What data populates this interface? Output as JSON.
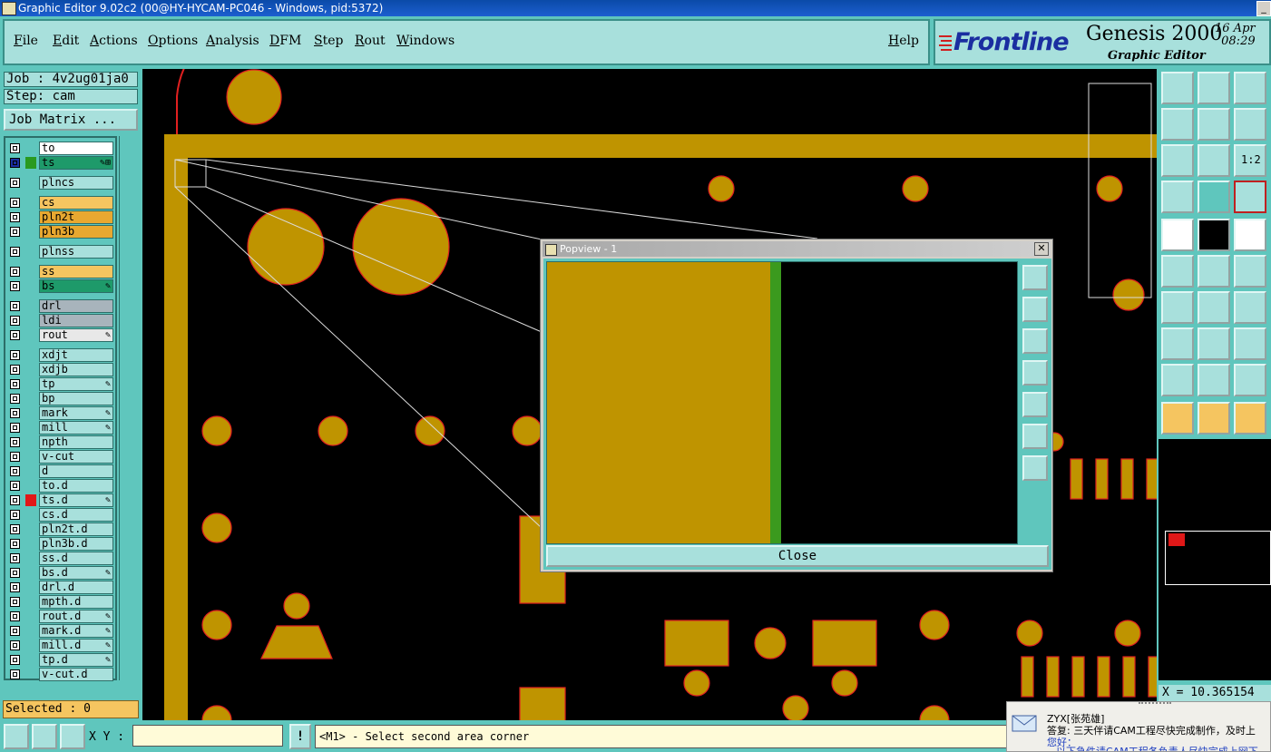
{
  "window": {
    "title": "Graphic Editor 9.02c2 (00@HY-HYCAM-PC046 - Windows, pid:5372)"
  },
  "menu": [
    "File",
    "Edit",
    "Actions",
    "Options",
    "Analysis",
    "DFM",
    "Step",
    "Rout",
    "Windows"
  ],
  "help_label": "Help",
  "brand": {
    "logo": "Frontline",
    "app": "Genesis 2000",
    "date": "16 Apr",
    "time": "08:29",
    "subtitle": "Graphic Editor"
  },
  "job": {
    "job_label": "Job : 4v2ug01ja0",
    "step_label": "Step: cam",
    "matrix_button": "Job Matrix ..."
  },
  "layers": [
    {
      "name": "to",
      "color": "#ffffff",
      "mark": "",
      "flag": ""
    },
    {
      "name": "ts",
      "color": "#1e9a6a",
      "mark": "#2a9a20",
      "flag": "✎⊞",
      "active": true
    },
    {
      "name": "plncs",
      "color": "#a8e0dc",
      "mark": "",
      "flag": ""
    },
    {
      "name": "cs",
      "color": "#f5c560",
      "mark": "",
      "flag": ""
    },
    {
      "name": "pln2t",
      "color": "#e8a830",
      "mark": "",
      "flag": ""
    },
    {
      "name": "pln3b",
      "color": "#e8a830",
      "mark": "",
      "flag": ""
    },
    {
      "name": "plnss",
      "color": "#a8e0dc",
      "mark": "",
      "flag": ""
    },
    {
      "name": "ss",
      "color": "#f5c560",
      "mark": "",
      "flag": ""
    },
    {
      "name": "bs",
      "color": "#1e9a6a",
      "mark": "",
      "flag": "✎"
    },
    {
      "name": "drl",
      "color": "#a8b4bc",
      "mark": "",
      "flag": ""
    },
    {
      "name": "ldi",
      "color": "#a8b4bc",
      "mark": "",
      "flag": ""
    },
    {
      "name": "rout",
      "color": "#e8e8e8",
      "mark": "",
      "flag": "✎"
    },
    {
      "name": "xdjt",
      "color": "#a8e0dc",
      "mark": "",
      "flag": ""
    },
    {
      "name": "xdjb",
      "color": "#a8e0dc",
      "mark": "",
      "flag": ""
    },
    {
      "name": "tp",
      "color": "#a8e0dc",
      "mark": "",
      "flag": "✎"
    },
    {
      "name": "bp",
      "color": "#a8e0dc",
      "mark": "",
      "flag": ""
    },
    {
      "name": "mark",
      "color": "#a8e0dc",
      "mark": "",
      "flag": "✎"
    },
    {
      "name": "mill",
      "color": "#a8e0dc",
      "mark": "",
      "flag": "✎"
    },
    {
      "name": "npth",
      "color": "#a8e0dc",
      "mark": "",
      "flag": ""
    },
    {
      "name": "v-cut",
      "color": "#a8e0dc",
      "mark": "",
      "flag": ""
    },
    {
      "name": "d",
      "color": "#a8e0dc",
      "mark": "",
      "flag": ""
    },
    {
      "name": "to.d",
      "color": "#a8e0dc",
      "mark": "",
      "flag": ""
    },
    {
      "name": "ts.d",
      "color": "#a8e0dc",
      "mark": "#e01818",
      "flag": "✎"
    },
    {
      "name": "cs.d",
      "color": "#a8e0dc",
      "mark": "",
      "flag": ""
    },
    {
      "name": "pln2t.d",
      "color": "#a8e0dc",
      "mark": "",
      "flag": ""
    },
    {
      "name": "pln3b.d",
      "color": "#a8e0dc",
      "mark": "",
      "flag": ""
    },
    {
      "name": "ss.d",
      "color": "#a8e0dc",
      "mark": "",
      "flag": ""
    },
    {
      "name": "bs.d",
      "color": "#a8e0dc",
      "mark": "",
      "flag": "✎"
    },
    {
      "name": "drl.d",
      "color": "#a8e0dc",
      "mark": "",
      "flag": ""
    },
    {
      "name": "mpth.d",
      "color": "#a8e0dc",
      "mark": "",
      "flag": ""
    },
    {
      "name": "rout.d",
      "color": "#a8e0dc",
      "mark": "",
      "flag": "✎"
    },
    {
      "name": "mark.d",
      "color": "#a8e0dc",
      "mark": "",
      "flag": "✎"
    },
    {
      "name": "mill.d",
      "color": "#a8e0dc",
      "mark": "",
      "flag": "✎"
    },
    {
      "name": "tp.d",
      "color": "#a8e0dc",
      "mark": "",
      "flag": "✎"
    },
    {
      "name": "v-cut.d",
      "color": "#a8e0dc",
      "mark": "",
      "flag": ""
    }
  ],
  "selected_label": "Selected : 0",
  "popview": {
    "title": "Popview - 1",
    "close_button": "Close"
  },
  "coord_readout": "X = 10.365154",
  "bottom": {
    "xy_label": "X Y :",
    "xy_value": "",
    "warn": "!",
    "status": "<M1> - Select second area corner"
  },
  "notification": {
    "sender": "ZYX[张苑雄]",
    "line1": "答复: 三天伴请CAM工程尽快完成制作，及时上",
    "line2": "您好：",
    "line3": "以下急件请CAM工程各负责人尽快完成上网下"
  },
  "colors": {
    "copper": "#bf9400",
    "pad_outline": "#e02020",
    "panel": "#5fc6bd",
    "button": "#a8e0dc"
  }
}
